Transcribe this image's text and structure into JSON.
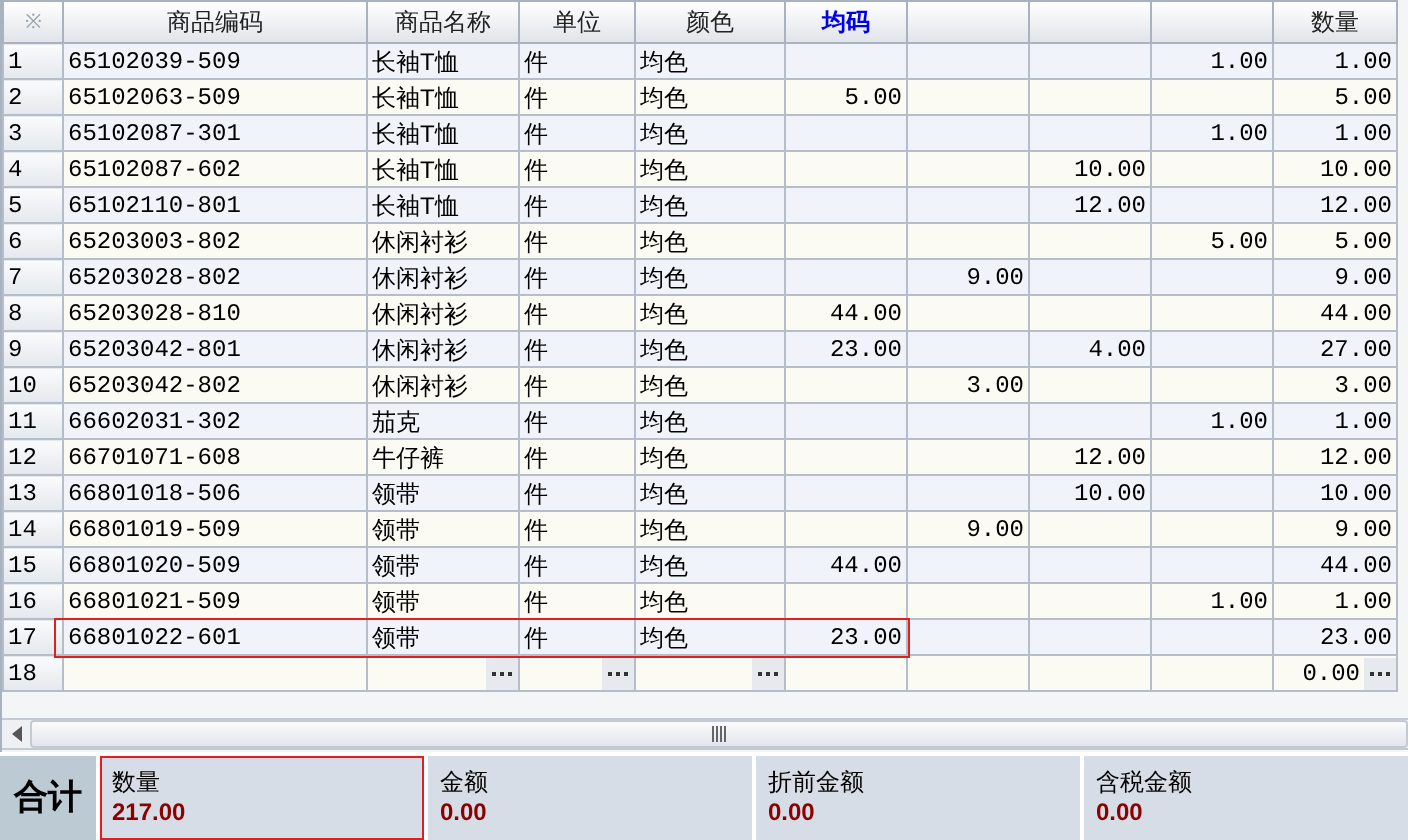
{
  "table": {
    "corner": "※",
    "columns": [
      {
        "label": "商品编码",
        "emphasis": false
      },
      {
        "label": "商品名称",
        "emphasis": false
      },
      {
        "label": "单位",
        "emphasis": false
      },
      {
        "label": "颜色",
        "emphasis": false
      },
      {
        "label": "均码",
        "emphasis": true
      },
      null,
      null,
      null,
      {
        "label": "数量",
        "emphasis": false
      }
    ],
    "rows": [
      {
        "number": "1",
        "cells": [
          "65102039-509",
          "长袖T恤",
          "件",
          "均色",
          "",
          "",
          "",
          "1.00",
          "1.00"
        ],
        "highlighted": false,
        "editing": false
      },
      {
        "number": "2",
        "cells": [
          "65102063-509",
          "长袖T恤",
          "件",
          "均色",
          "5.00",
          "",
          "",
          "",
          "5.00"
        ],
        "highlighted": false,
        "editing": false
      },
      {
        "number": "3",
        "cells": [
          "65102087-301",
          "长袖T恤",
          "件",
          "均色",
          "",
          "",
          "",
          "1.00",
          "1.00"
        ],
        "highlighted": false,
        "editing": false
      },
      {
        "number": "4",
        "cells": [
          "65102087-602",
          "长袖T恤",
          "件",
          "均色",
          "",
          "",
          "10.00",
          "",
          "10.00"
        ],
        "highlighted": false,
        "editing": false
      },
      {
        "number": "5",
        "cells": [
          "65102110-801",
          "长袖T恤",
          "件",
          "均色",
          "",
          "",
          "12.00",
          "",
          "12.00"
        ],
        "highlighted": false,
        "editing": false
      },
      {
        "number": "6",
        "cells": [
          "65203003-802",
          "休闲衬衫",
          "件",
          "均色",
          "",
          "",
          "",
          "5.00",
          "5.00"
        ],
        "highlighted": false,
        "editing": false
      },
      {
        "number": "7",
        "cells": [
          "65203028-802",
          "休闲衬衫",
          "件",
          "均色",
          "",
          "9.00",
          "",
          "",
          "9.00"
        ],
        "highlighted": false,
        "editing": false
      },
      {
        "number": "8",
        "cells": [
          "65203028-810",
          "休闲衬衫",
          "件",
          "均色",
          "44.00",
          "",
          "",
          "",
          "44.00"
        ],
        "highlighted": false,
        "editing": false
      },
      {
        "number": "9",
        "cells": [
          "65203042-801",
          "休闲衬衫",
          "件",
          "均色",
          "23.00",
          "",
          "4.00",
          "",
          "27.00"
        ],
        "highlighted": false,
        "editing": false
      },
      {
        "number": "10",
        "cells": [
          "65203042-802",
          "休闲衬衫",
          "件",
          "均色",
          "",
          "3.00",
          "",
          "",
          "3.00"
        ],
        "highlighted": false,
        "editing": false
      },
      {
        "number": "11",
        "cells": [
          "66602031-302",
          "茄克",
          "件",
          "均色",
          "",
          "",
          "",
          "1.00",
          "1.00"
        ],
        "highlighted": false,
        "editing": false
      },
      {
        "number": "12",
        "cells": [
          "66701071-608",
          "牛仔裤",
          "件",
          "均色",
          "",
          "",
          "12.00",
          "",
          "12.00"
        ],
        "highlighted": false,
        "editing": false
      },
      {
        "number": "13",
        "cells": [
          "66801018-506",
          "领带",
          "件",
          "均色",
          "",
          "",
          "10.00",
          "",
          "10.00"
        ],
        "highlighted": false,
        "editing": false
      },
      {
        "number": "14",
        "cells": [
          "66801019-509",
          "领带",
          "件",
          "均色",
          "",
          "9.00",
          "",
          "",
          "9.00"
        ],
        "highlighted": false,
        "editing": false
      },
      {
        "number": "15",
        "cells": [
          "66801020-509",
          "领带",
          "件",
          "均色",
          "44.00",
          "",
          "",
          "",
          "44.00"
        ],
        "highlighted": false,
        "editing": false
      },
      {
        "number": "16",
        "cells": [
          "66801021-509",
          "领带",
          "件",
          "均色",
          "",
          "",
          "",
          "1.00",
          "1.00"
        ],
        "highlighted": false,
        "editing": false
      },
      {
        "number": "17",
        "cells": [
          "66801022-601",
          "领带",
          "件",
          "均色",
          "23.00",
          "",
          "",
          "",
          "23.00"
        ],
        "highlighted": true,
        "editing": false
      },
      {
        "number": "18",
        "cells": [
          "",
          "",
          "",
          "",
          "",
          "",
          "",
          "",
          "0.00"
        ],
        "highlighted": false,
        "editing": true
      }
    ]
  },
  "totals": {
    "label": "合计",
    "items": [
      {
        "label": "数量",
        "value": "217.00",
        "highlighted": true
      },
      {
        "label": "金额",
        "value": "0.00",
        "highlighted": false
      },
      {
        "label": "折前金额",
        "value": "0.00",
        "highlighted": false
      },
      {
        "label": "含税金额",
        "value": "0.00",
        "highlighted": false
      }
    ]
  }
}
